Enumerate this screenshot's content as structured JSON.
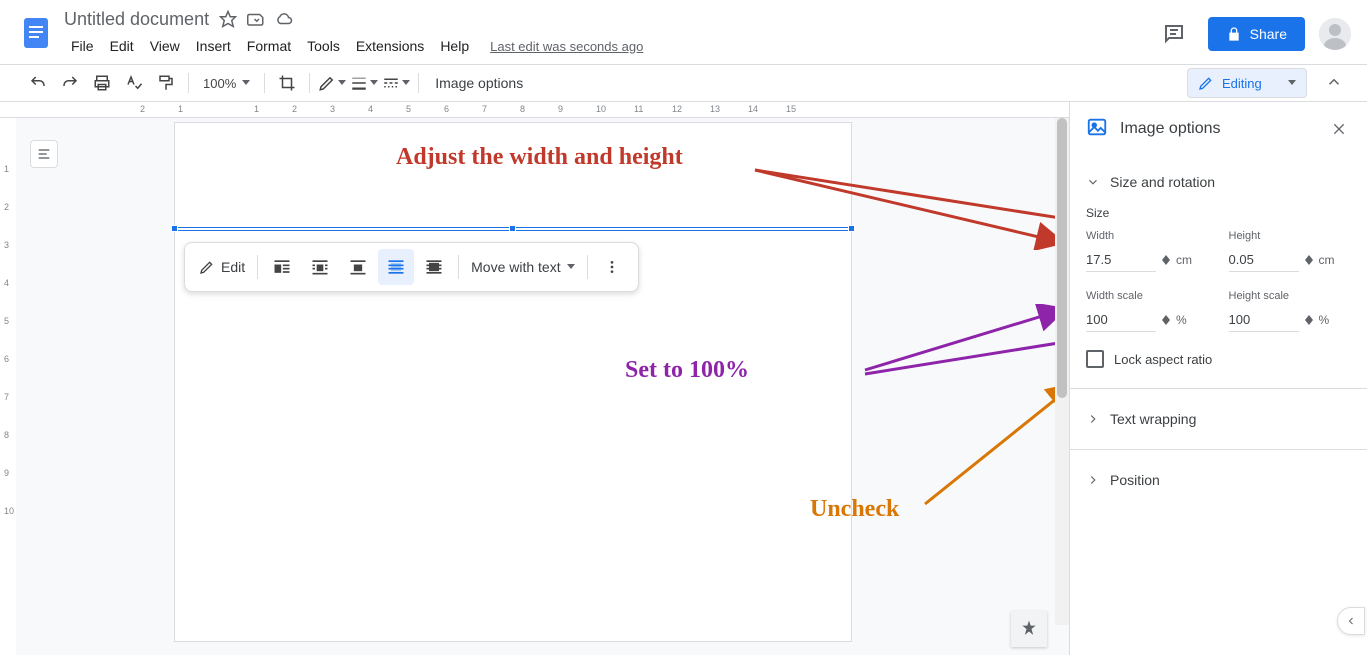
{
  "header": {
    "doc_title": "Untitled document",
    "last_edit": "Last edit was seconds ago",
    "share_label": "Share"
  },
  "menubar": {
    "file": "File",
    "edit": "Edit",
    "view": "View",
    "insert": "Insert",
    "format": "Format",
    "tools": "Tools",
    "extensions": "Extensions",
    "help": "Help"
  },
  "toolbar": {
    "zoom": "100%",
    "image_options": "Image options",
    "editing": "Editing"
  },
  "float": {
    "edit": "Edit",
    "move_with_text": "Move with text"
  },
  "panel": {
    "title": "Image options",
    "size_rotation": "Size and rotation",
    "size_label": "Size",
    "width_label": "Width",
    "width_value": "17.5",
    "width_unit": "cm",
    "height_label": "Height",
    "height_value": "0.05",
    "height_unit": "cm",
    "width_scale_label": "Width scale",
    "width_scale_value": "100",
    "width_scale_unit": "%",
    "height_scale_label": "Height scale",
    "height_scale_value": "100",
    "height_scale_unit": "%",
    "lock_aspect": "Lock aspect ratio",
    "text_wrapping": "Text wrapping",
    "position": "Position"
  },
  "ruler": {
    "h": [
      "2",
      "1",
      "",
      "1",
      "2",
      "3",
      "4",
      "5",
      "6",
      "7",
      "8",
      "9",
      "10",
      "11",
      "12",
      "13",
      "14",
      "15"
    ],
    "v": [
      "",
      "1",
      "2",
      "3",
      "4",
      "5",
      "6",
      "7",
      "8",
      "9",
      "10"
    ]
  },
  "annotations": {
    "adjust": "Adjust the width and height",
    "set100": "Set to 100%",
    "uncheck": "Uncheck"
  },
  "colors": {
    "red": "#c0392b",
    "purple": "#8e24aa",
    "orange": "#d97706"
  }
}
